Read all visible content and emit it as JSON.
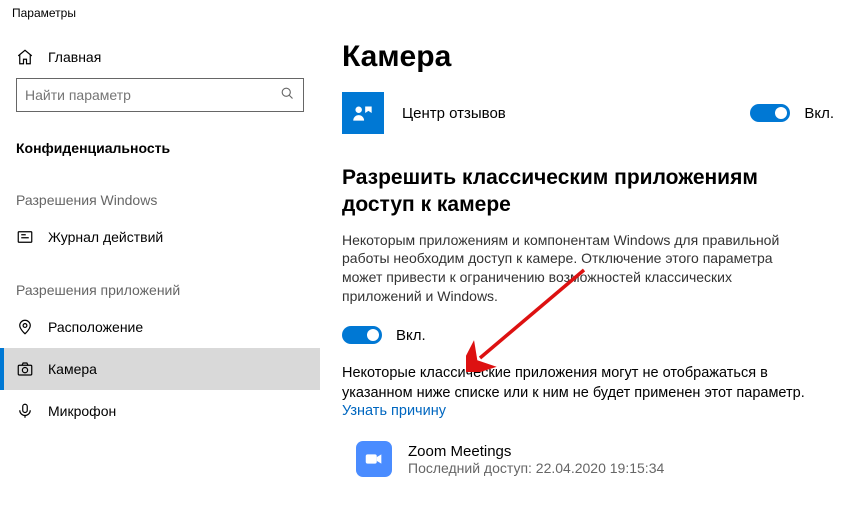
{
  "window_title": "Параметры",
  "sidebar": {
    "home_label": "Главная",
    "search_placeholder": "Найти параметр",
    "privacy_label": "Конфиденциальность",
    "section_windows": "Разрешения Windows",
    "activity_label": "Журнал действий",
    "section_apps": "Разрешения приложений",
    "location_label": "Расположение",
    "camera_label": "Камера",
    "microphone_label": "Микрофон"
  },
  "main": {
    "title": "Камера",
    "feedback_app": "Центр отзывов",
    "feedback_toggle_label": "Вкл.",
    "allow_classic_heading": "Разрешить классическим приложениям доступ к камере",
    "allow_classic_desc": "Некоторым приложениям и компонентам Windows для правильной работы необходим доступ к камере. Отключение этого параметра может привести к ограничению возможностей классических приложений и Windows.",
    "allow_classic_toggle_label": "Вкл.",
    "note": "Некоторые классические приложения могут не отображаться в указанном ниже списке или к ним не будет применен этот параметр.",
    "learn_why": "Узнать причину",
    "classic_app_name": "Zoom Meetings",
    "classic_app_sub": "Последний доступ: 22.04.2020 19:15:34"
  }
}
